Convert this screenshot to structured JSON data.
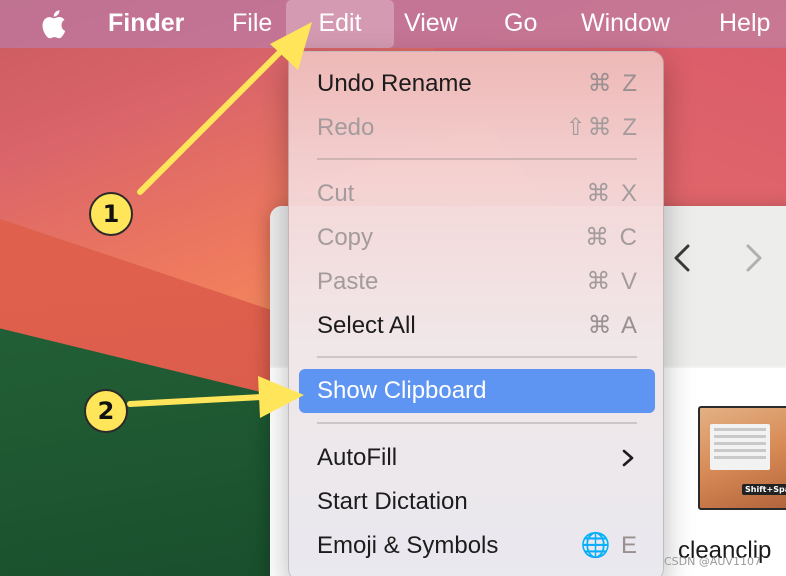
{
  "menubar": {
    "app_name": "Finder",
    "items": [
      "File",
      "Edit",
      "View",
      "Go",
      "Window",
      "Help"
    ],
    "active_item": "Edit"
  },
  "edit_menu": {
    "items": [
      {
        "label": "Undo Rename",
        "shortcut": "⌘ Z",
        "state": "enabled"
      },
      {
        "label": "Redo",
        "shortcut": "⇧⌘ Z",
        "state": "disabled"
      },
      {
        "label": "Cut",
        "shortcut": "⌘ X",
        "state": "disabled"
      },
      {
        "label": "Copy",
        "shortcut": "⌘ C",
        "state": "disabled"
      },
      {
        "label": "Paste",
        "shortcut": "⌘ V",
        "state": "disabled"
      },
      {
        "label": "Select All",
        "shortcut": "⌘ A",
        "state": "enabled"
      },
      {
        "label": "Show Clipboard",
        "shortcut": "",
        "state": "selected"
      },
      {
        "label": "AutoFill",
        "shortcut": "",
        "state": "enabled",
        "submenu": true
      },
      {
        "label": "Start Dictation",
        "shortcut": "",
        "state": "enabled"
      },
      {
        "label": "Emoji & Symbols",
        "shortcut": "🌐 E",
        "state": "enabled"
      }
    ]
  },
  "finder_window": {
    "file_label": "cleanclip",
    "thumb_badge": "Shift+Space"
  },
  "annotations": {
    "step1": "1",
    "step2": "2",
    "arrow_color": "#ffe55a"
  },
  "watermark": "CSDN @AUV1107"
}
